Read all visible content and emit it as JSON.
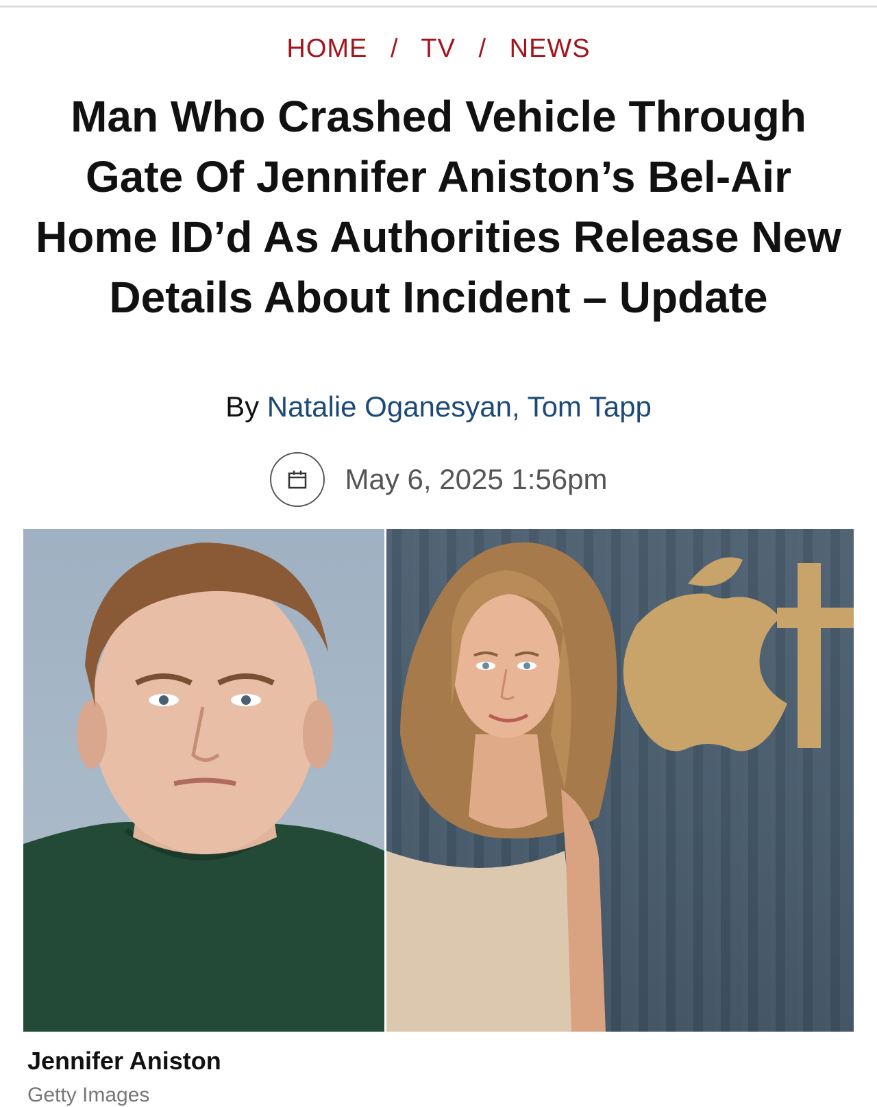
{
  "breadcrumb": {
    "items": [
      "HOME",
      "TV",
      "NEWS"
    ],
    "separator": "/"
  },
  "article": {
    "title": "Man Who Crashed Vehicle Through Gate Of Jennifer Aniston’s Bel-Air Home ID’d As Authorities Release New Details About Incident – Update",
    "byline_prefix": "By",
    "authors": "Natalie Oganesyan, Tom Tapp",
    "date": "May 6, 2025 1:56pm"
  },
  "hero": {
    "caption": "Jennifer Aniston",
    "credit": "Getty Images"
  },
  "icons": {
    "date": "calendar-icon"
  },
  "colors": {
    "breadcrumb": "#a3141b",
    "author_link": "#1c4a78",
    "headline": "#111111",
    "date_text": "#555555"
  }
}
